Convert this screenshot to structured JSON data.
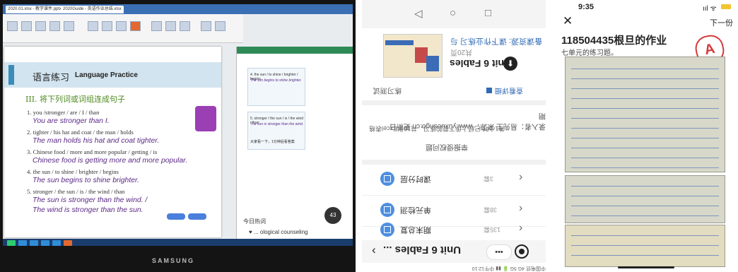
{
  "panel1": {
    "tabs": [
      "2020.01.xlsx - 教学课件.pptx",
      "2020Guide - 英语作业总结.xlsx"
    ],
    "slide": {
      "title_zh": "语言练习",
      "title_en": "Language Practice",
      "section": "III. 将下列词或词组连成句子",
      "items": [
        {
          "q": "1. you /stronger / are / I / than",
          "a": [
            "You are stronger than I."
          ]
        },
        {
          "q": "2. tighter / his hat and coat / the man / holds",
          "a": [
            "The man holds his hat and coat tighter."
          ]
        },
        {
          "q": "3. Chinese food / more and more popular / getting / is",
          "a": [
            "Chinese food is getting more and more popular."
          ]
        },
        {
          "q": "4. the sun / to shine / brighter / begins",
          "a": [
            "The sun begins to shine brighter."
          ]
        },
        {
          "q": "5. stronger / the sun / is / the wind / than",
          "a": [
            "The sun is stronger than the wind. /",
            "The wind is stronger than the sun."
          ]
        }
      ]
    },
    "chat_snippets": [
      "4. the sun / to shine / brighter / begins",
      "The sun begins to shine brighter.",
      "5. stronger / the sun / is / the wind / than",
      "The sun is stronger than the wind.",
      "大家看一下，1分钟后看答案"
    ],
    "hot_label": "今日热词",
    "hot_item": "♥ ... ological counseling",
    "bubble_count": "43",
    "brand": "SAMSUNG"
  },
  "panel2": {
    "nav": [
      "◁",
      "○",
      "□"
    ],
    "card": {
      "title": "备课资源: 课下作业练习 与",
      "meta": "共20页",
      "name": "Unit 6 Fables"
    },
    "section_left": "练习测试",
    "section_right": "查看详细",
    "info1": "录入者：易先生 来源：www.yuxuesngo.cn 更新日期",
    "info2": "共1小时 已经上传下载的练习，共10张Excel表格",
    "report": "举报侵权问题",
    "rows": [
      {
        "label": "课时分层",
        "count": "3套"
      },
      {
        "label": "单元检测",
        "count": "38套"
      },
      {
        "label": "期末总复",
        "count": "135套"
      }
    ],
    "bottom_title": "Unit 6 Fables ...",
    "more": "•••",
    "status": "中国电信                     4G 5G 🔋 ▮▮ 中午12:10"
  },
  "panel3": {
    "time": "9:35",
    "signal": "ııl ᯤ",
    "close": "✕",
    "next": "下一份",
    "title": "118504435根旦的作业",
    "subtitle": "七单元的练习题。",
    "grade": "A"
  }
}
